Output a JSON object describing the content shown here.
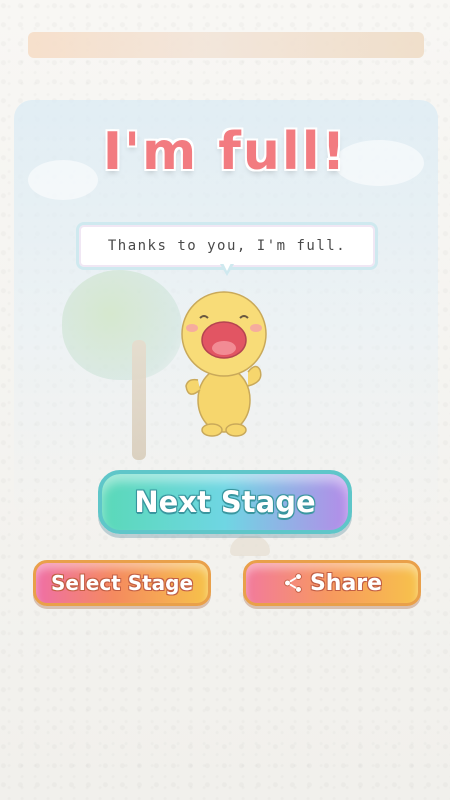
{
  "title": "I'm full!",
  "speech": "Thanks to you, I'm full.",
  "buttons": {
    "next_stage": "Next Stage",
    "select_stage": "Select Stage",
    "share": "Share"
  },
  "icons": {
    "share": "share-icon"
  },
  "colors": {
    "title": "#f27b80",
    "next_button": "#6fd6e3",
    "select_button": "#f58a5f",
    "share_button": "#f79a5e"
  }
}
